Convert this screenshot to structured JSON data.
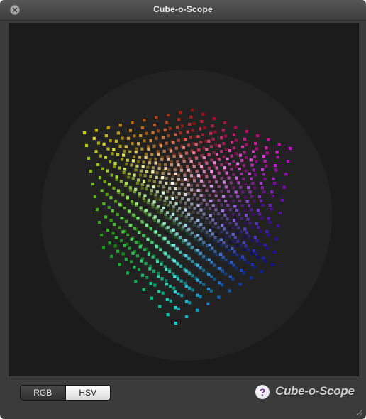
{
  "window": {
    "title": "Cube-o-Scope"
  },
  "viewport": {
    "description_icon": "rgb-color-cube-icon"
  },
  "mode_control": {
    "options": [
      {
        "label": "RGB",
        "selected": false
      },
      {
        "label": "HSV",
        "selected": true
      }
    ]
  },
  "footer": {
    "help_label": "?",
    "brand": "Cube-o-Scope"
  },
  "colors": {
    "window_bg": "#3b3b3b",
    "viewport_bg": "#1b1b1b",
    "help_accent": "#6a38a8"
  }
}
